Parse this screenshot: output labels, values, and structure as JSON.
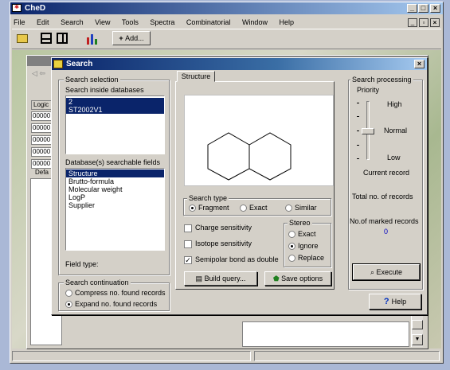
{
  "app": {
    "title": "CheD",
    "menu": [
      "File",
      "Edit",
      "Search",
      "View",
      "Tools",
      "Spectra",
      "Combinatorial",
      "Window",
      "Help"
    ],
    "toolbar": {
      "add_label": "Add..."
    }
  },
  "bg_window": {
    "logic_header": "Logic",
    "rows": [
      "00000",
      "00000",
      "00000",
      "00000",
      "00000"
    ],
    "default_tab": "Defa"
  },
  "dialog": {
    "title": "Search",
    "search_selection": {
      "group_label": "Search selection",
      "databases_label": "Search inside databases",
      "databases": [
        {
          "label": "2",
          "selected": true
        },
        {
          "label": "ST2002V1",
          "selected": true
        }
      ],
      "fields_label": "Database(s) searchable fields",
      "fields": [
        {
          "label": "Structure",
          "selected": true
        },
        {
          "label": "Brutto-formula",
          "selected": false
        },
        {
          "label": "Molecular weight",
          "selected": false
        },
        {
          "label": "LogP",
          "selected": false
        },
        {
          "label": "Supplier",
          "selected": false
        }
      ],
      "field_type_label": "Field type:"
    },
    "search_continuation": {
      "group_label": "Search continuation",
      "options": [
        {
          "label": "Compress no. found records",
          "checked": false
        },
        {
          "label": "Expand no. found records",
          "checked": true
        }
      ]
    },
    "structure_tab": "Structure",
    "search_type": {
      "group_label": "Search type",
      "options": [
        {
          "label": "Fragment",
          "checked": true
        },
        {
          "label": "Exact",
          "checked": false
        },
        {
          "label": "Similar",
          "checked": false
        }
      ]
    },
    "checkboxes": [
      {
        "label": "Charge sensitivity",
        "checked": false
      },
      {
        "label": "Isotope sensitivity",
        "checked": false
      },
      {
        "label": "Semipolar bond as double",
        "checked": true
      }
    ],
    "stereo": {
      "group_label": "Stereo",
      "options": [
        {
          "label": "Exact",
          "checked": false
        },
        {
          "label": "Ignore",
          "checked": true
        },
        {
          "label": "Replace",
          "checked": false
        }
      ]
    },
    "build_query_label": "Build query...",
    "save_options_label": "Save options",
    "processing": {
      "group_label": "Search processing",
      "priority_label": "Priority",
      "high": "High",
      "normal": "Normal",
      "low": "Low",
      "current_record": "Current record",
      "total_records": "Total no. of records",
      "marked_records": "No.of marked records",
      "marked_value": "0",
      "execute_label": "Execute"
    },
    "help_label": "Help"
  }
}
